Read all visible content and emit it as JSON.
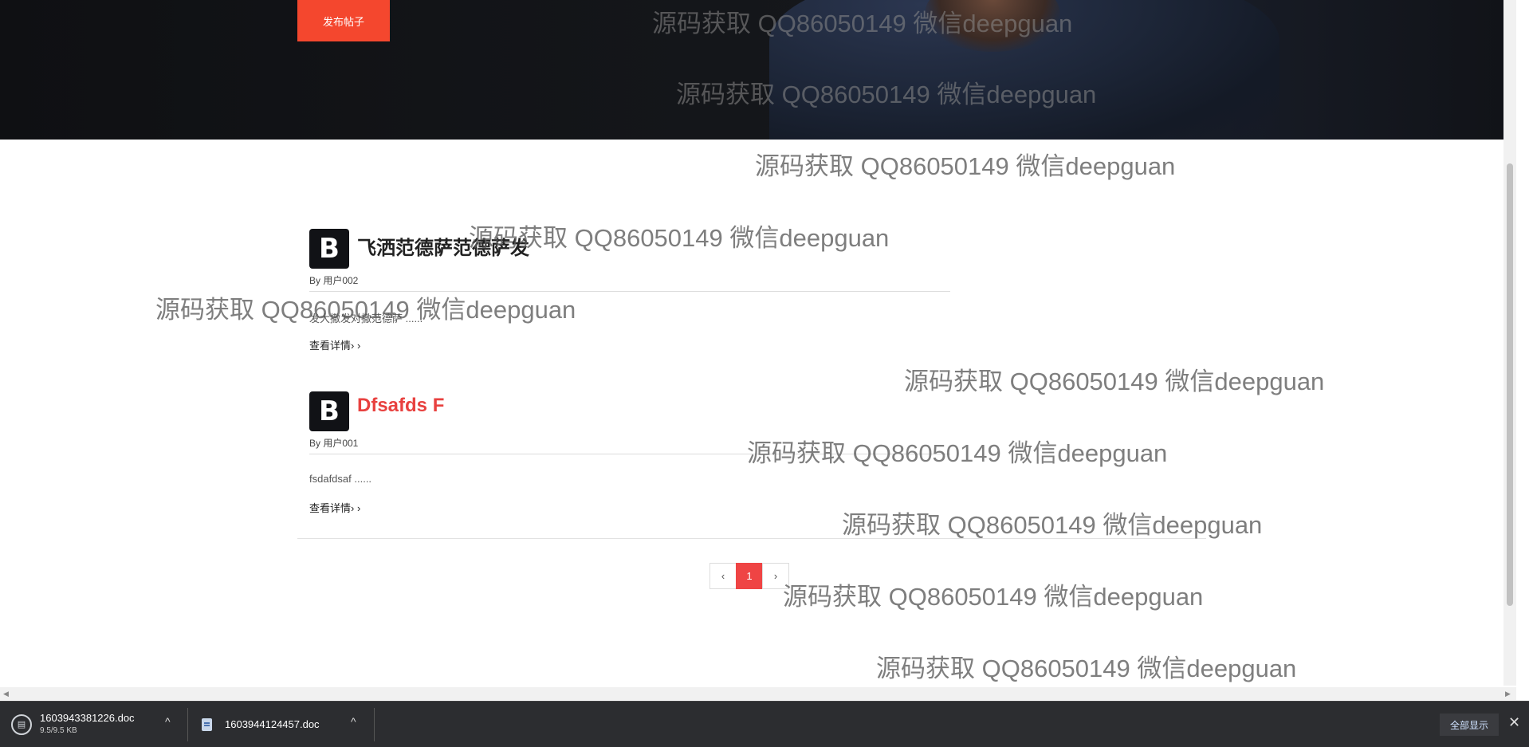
{
  "hero": {
    "publish_label": "发布帖子"
  },
  "posts": [
    {
      "logo": "B",
      "title": "飞洒范德萨范德萨发",
      "author": "By 用户002",
      "excerpt": "发大撒发对撒范德萨 ......",
      "more": "查看详情› ›"
    },
    {
      "logo": "B",
      "title": "Dfsafds F",
      "author": "By 用户001",
      "excerpt": "fsdafdsaf ......",
      "more": "查看详情› ›"
    }
  ],
  "pagination": {
    "prev": "‹",
    "current": "1",
    "next": "›"
  },
  "watermark": "源码获取 QQ86050149 微信deepguan",
  "downloads": [
    {
      "name": "1603943381226.doc",
      "size": "9.5/9.5 KB"
    },
    {
      "name": "1603944124457.doc"
    }
  ],
  "download_bar": {
    "show_all": "全部显示",
    "close": "✕",
    "chevron": "^"
  },
  "icons": [
    "download-progress-icon",
    "doc-file-icon",
    "chevron-up-icon",
    "close-icon"
  ],
  "colors": {
    "accent": "#f4472e",
    "page_active": "#ef4444",
    "title_red": "#e8413f"
  }
}
